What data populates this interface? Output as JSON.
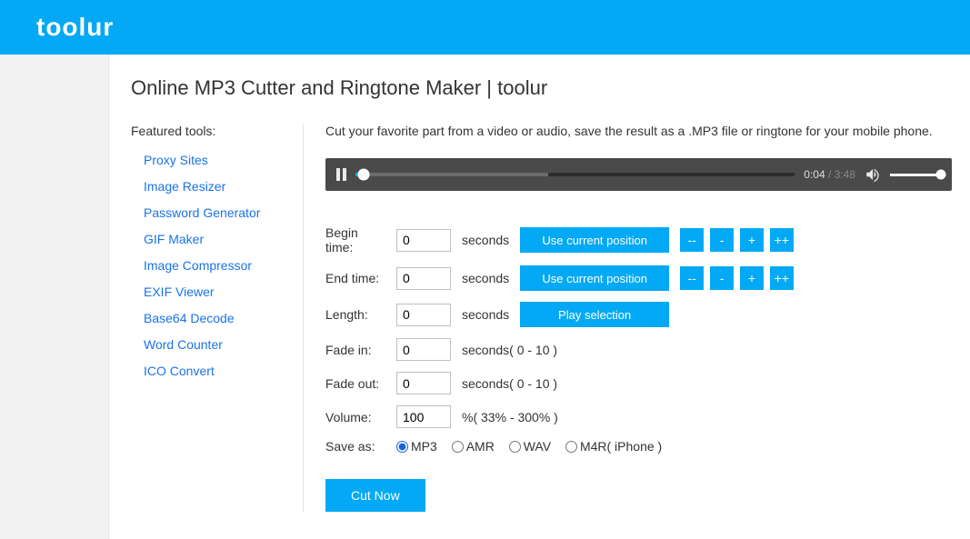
{
  "brand": "toolur",
  "pageTitle": "Online MP3 Cutter and Ringtone Maker | toolur",
  "sidebar": {
    "heading": "Featured tools:",
    "items": [
      {
        "label": "Proxy Sites"
      },
      {
        "label": "Image Resizer"
      },
      {
        "label": "Password Generator"
      },
      {
        "label": "GIF Maker"
      },
      {
        "label": "Image Compressor"
      },
      {
        "label": "EXIF Viewer"
      },
      {
        "label": "Base64 Decode"
      },
      {
        "label": "Word Counter"
      },
      {
        "label": "ICO Convert"
      }
    ]
  },
  "description": "Cut your favorite part from a video or audio, save the result as a .MP3 file or ringtone for your mobile phone.",
  "player": {
    "elapsed": "0:04",
    "duration": "3:48"
  },
  "form": {
    "beginLabel": "Begin time:",
    "beginValue": "0",
    "beginUnit": "seconds",
    "endLabel": "End time:",
    "endValue": "0",
    "endUnit": "seconds",
    "lengthLabel": "Length:",
    "lengthValue": "0",
    "lengthUnit": "seconds",
    "fadeInLabel": "Fade in:",
    "fadeInValue": "0",
    "fadeInHint": "seconds( 0 - 10 )",
    "fadeOutLabel": "Fade out:",
    "fadeOutValue": "0",
    "fadeOutHint": "seconds( 0 - 10 )",
    "volumeLabel": "Volume:",
    "volumeValue": "100",
    "volumeHint": "%( 33% - 300% )",
    "saveAsLabel": "Save as:"
  },
  "buttons": {
    "useCurrent": "Use current position",
    "playSelection": "Play selection",
    "dec2": "--",
    "dec1": "-",
    "inc1": "+",
    "inc2": "++",
    "cutNow": "Cut Now"
  },
  "formats": {
    "mp3": "MP3",
    "amr": "AMR",
    "wav": "WAV",
    "m4r": "M4R( iPhone )"
  }
}
